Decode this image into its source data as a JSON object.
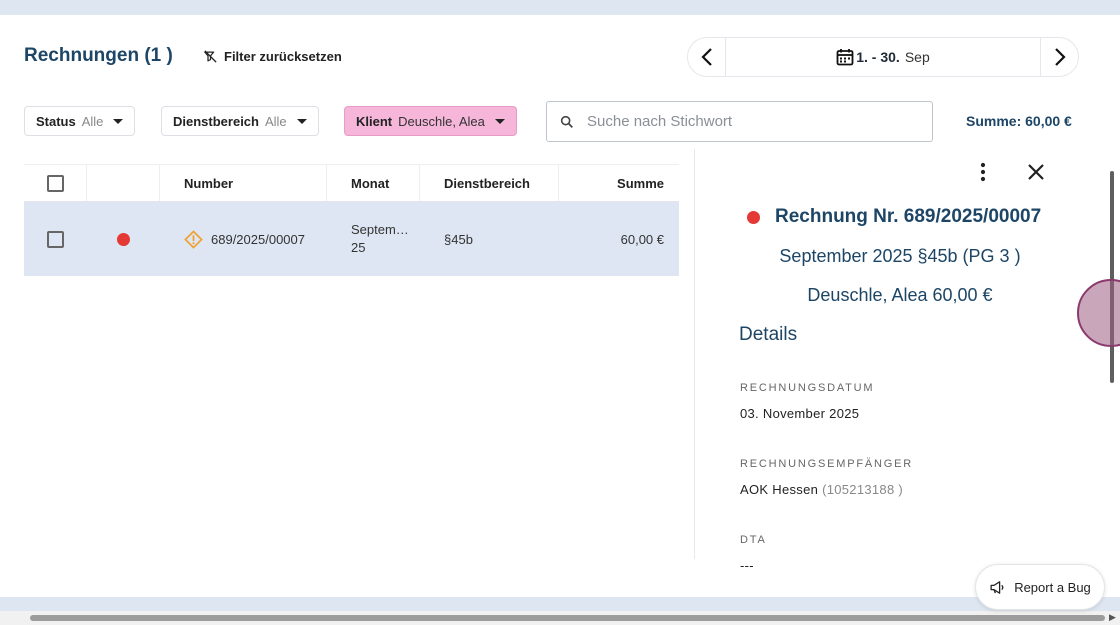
{
  "header": {
    "title": "Rechnungen (1 )",
    "filter_reset_label": "Filter zurücksetzen"
  },
  "date_nav": {
    "range_start": "1. - 30.",
    "month": "Sep"
  },
  "filters": {
    "status": {
      "key": "Status",
      "value": "Alle"
    },
    "dienstbereich": {
      "key": "Dienstbereich",
      "value": "Alle"
    },
    "klient": {
      "key": "Klient",
      "value": "Deuschle, Alea"
    }
  },
  "search": {
    "placeholder": "Suche nach Stichwort"
  },
  "summe": "Summe: 60,00 €",
  "table": {
    "columns": [
      "Number",
      "Monat",
      "Dienstbereich",
      "Summe"
    ],
    "rows": [
      {
        "number": "689/2025/00007",
        "monat_line1": "Septem…",
        "monat_line2": "25",
        "dienstbereich": "§45b",
        "summe": "60,00 €"
      }
    ]
  },
  "detail": {
    "title": "Rechnung Nr. 689/2025/00007",
    "subtitle": "September 2025 §45b (PG 3 )",
    "client_amount": "Deuschle, Alea 60,00 €",
    "section": "Details",
    "fields": [
      {
        "label": "RECHNUNGSDATUM",
        "value": "03. November 2025",
        "extra": ""
      },
      {
        "label": "RECHNUNGSEMPFÄNGER",
        "value": "AOK Hessen",
        "extra": "(105213188 )"
      },
      {
        "label": "DTA",
        "value": "---",
        "extra": ""
      }
    ]
  },
  "bug_button": "Report a Bug",
  "colors": {
    "primary": "#1d4566",
    "active_chip": "#f5b6d9",
    "selected_row": "#dde6f2",
    "status_red": "#e53935",
    "warning": "#f0a030"
  }
}
